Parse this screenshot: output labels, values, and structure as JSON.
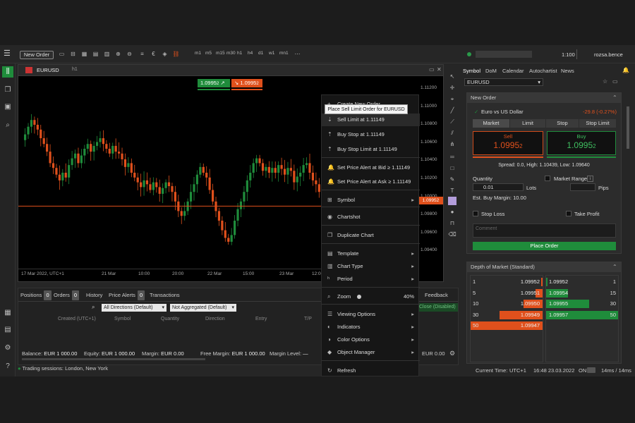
{
  "toolbar": {
    "new_order_label": "New Order",
    "leverage": "1:100",
    "username": "rozsa.bence",
    "period_labels": [
      "m1",
      "m5",
      "m15",
      "m30",
      "h1",
      "h4",
      "d1",
      "w1",
      "mn1"
    ]
  },
  "chart": {
    "symbol": "EURUSD",
    "period": "h1",
    "order_badges": {
      "buy_price": "1.0995",
      "buy_suffix": "2",
      "sell_price": "1.0995",
      "sell_suffix": "2"
    },
    "price_labels": [
      "1.11200",
      "1.11000",
      "1.10800",
      "1.10600",
      "1.10400",
      "1.10200",
      "1.10000",
      "1.09800",
      "1.09600",
      "1.09400"
    ],
    "current_price_label": "1.09952",
    "time_labels": [
      "17 Mar 2022, UTC+1",
      "21 Mar",
      "10:00",
      "20:00",
      "22 Mar",
      "15:00",
      "23 Mar",
      "12:00"
    ]
  },
  "chart_data": {
    "type": "candlestick",
    "symbol": "EURUSD",
    "period": "h1",
    "ylim": [
      1.093,
      1.113
    ],
    "current_price": 1.09952,
    "closes": [
      1.107,
      1.1078,
      1.1085,
      1.108,
      1.1075,
      1.1066,
      1.106,
      1.1052,
      1.104,
      1.1035,
      1.1028,
      1.1022,
      1.103,
      1.1025,
      1.1038,
      1.1045,
      1.105,
      1.104,
      1.1048,
      1.1055,
      1.106,
      1.1052,
      1.1058,
      1.1062,
      1.1066,
      1.106,
      1.1055,
      1.105,
      1.1058,
      1.1052,
      1.105,
      1.1044,
      1.1036,
      1.104,
      1.103,
      1.1025,
      1.102,
      1.1015,
      1.1022,
      1.1018,
      1.1012,
      1.102,
      1.1015,
      1.1008,
      1.1014,
      1.102,
      1.1016,
      1.101,
      1.1,
      1.099,
      1.0985,
      1.099,
      1.1,
      1.101,
      1.1018,
      1.1028,
      1.1036,
      1.103,
      1.1025,
      1.1012,
      1.1,
      1.099,
      1.098,
      1.097,
      1.0962,
      1.0958,
      1.0965,
      1.098,
      1.0992,
      1.1,
      1.101,
      1.1022,
      1.103,
      1.104,
      1.1045,
      1.104,
      1.1032,
      1.1036,
      1.103,
      1.1035,
      1.103,
      1.1038,
      1.1034,
      1.1028,
      1.1035,
      1.1032,
      1.102,
      1.1026,
      1.103,
      1.1038,
      1.104,
      1.103,
      1.1022,
      1.1018,
      1.101,
      1.1,
      1.0995
    ]
  },
  "context_menu": {
    "tooltip": "Place Sell Limit Order for EURUSD",
    "create_new_order": "Create New Order",
    "items": [
      {
        "label": "Sell Limit at 1.11149",
        "icon": "sell-limit-icon"
      },
      {
        "label": "Buy Stop at 1.11149",
        "icon": "buy-stop-icon"
      },
      {
        "label": "Buy Stop Limit at 1.11149",
        "icon": "buy-stop-limit-icon"
      },
      {
        "label": "Set Price Alert at Bid ≥ 1.11149",
        "icon": "bell-icon"
      },
      {
        "label": "Set Price Alert at Ask ≥ 1.11149",
        "icon": "bell-icon"
      },
      {
        "label": "Symbol",
        "icon": "symbol-icon"
      },
      {
        "label": "Chartshot",
        "icon": "camera-icon"
      },
      {
        "label": "Duplicate Chart",
        "icon": "duplicate-icon"
      },
      {
        "label": "Template",
        "icon": "template-icon"
      },
      {
        "label": "Chart Type",
        "icon": "chart-type-icon"
      },
      {
        "label": "Period",
        "icon": "period-icon"
      },
      {
        "label": "Zoom",
        "icon": "zoom-icon"
      },
      {
        "label": "Viewing Options",
        "icon": "viewing-icon"
      },
      {
        "label": "Indicators",
        "icon": "indicators-icon"
      },
      {
        "label": "Color Options",
        "icon": "color-icon"
      },
      {
        "label": "Object Manager",
        "icon": "object-manager-icon"
      },
      {
        "label": "Refresh",
        "icon": "refresh-icon"
      }
    ],
    "zoom_value": "40%"
  },
  "bottom": {
    "tabs": [
      {
        "label": "Positions",
        "count": "0"
      },
      {
        "label": "Orders",
        "count": "0"
      },
      {
        "label": "History",
        "count": ""
      },
      {
        "label": "Price Alerts",
        "count": "0"
      },
      {
        "label": "Transactions",
        "count": ""
      }
    ],
    "filter_direction": "All Directions (Default)",
    "filter_aggregation": "Not Aggregated (Default)",
    "columns": [
      "Created (UTC+1)",
      "Symbol",
      "Quantity",
      "Direction",
      "Entry",
      "T/P"
    ],
    "feedback": "Feedback",
    "close_label": "Close (Disabled)",
    "balance_label": "Balance:",
    "balance": "EUR 1 000.00",
    "equity_label": "Equity:",
    "equity": "EUR 1 000.00",
    "margin_label": "Margin:",
    "margin": "EUR 0.00",
    "free_margin_label": "Free Margin:",
    "free_margin": "EUR 1 000.00",
    "margin_level_label": "Margin Level:",
    "margin_level": "—",
    "right_value": "EUR 0.00",
    "sessions": "Trading sessions: London, New York"
  },
  "right_panel": {
    "tabs": [
      "Symbol",
      "DoM",
      "Calendar",
      "Autochartist",
      "News"
    ],
    "symbol": "EURUSD",
    "new_order_title": "New Order",
    "instrument": "Euro vs US Dollar",
    "change": "-29.8 (-0.27%)",
    "order_types": [
      "Market",
      "Limit",
      "Stop",
      "Stop Limit"
    ],
    "sell_label": "Sell",
    "sell_price": "1.0995",
    "sell_suffix": "2",
    "buy_label": "Buy",
    "buy_price": "1.0995",
    "buy_suffix": "2",
    "spread_info": "Spread: 0.0, High: 1.10439, Low: 1.09640",
    "quantity_label": "Quantity",
    "quantity_value": "0.01",
    "lots_label": "Lots",
    "market_range_label": "Market Range",
    "pips_label": "Pips",
    "margin_info": "Est. Buy Margin: 10.00",
    "stop_loss_label": "Stop Loss",
    "take_profit_label": "Take Profit",
    "comment_placeholder": "Comment",
    "place_order_label": "Place Order",
    "dom_title": "Depth of Market (Standard)",
    "dom_sell": [
      {
        "size": "1",
        "price": "1.09952"
      },
      {
        "size": "5",
        "price": "1.09951"
      },
      {
        "size": "10",
        "price": "1.09950"
      },
      {
        "size": "30",
        "price": "1.09949"
      },
      {
        "size": "50",
        "price": "1.09947"
      }
    ],
    "dom_buy": [
      {
        "size": "1",
        "price": "1.09952"
      },
      {
        "size": "15",
        "price": "1.09954"
      },
      {
        "size": "30",
        "price": "1.09955"
      },
      {
        "size": "50",
        "price": "1.09957"
      }
    ]
  },
  "footer": {
    "current_time_label": "Current Time:",
    "timezone": "UTC+1",
    "datetime": "16:48 23.03.2022",
    "on_label": "ON",
    "latency": "14ms / 14ms"
  },
  "colors": {
    "sell": "#e0501c",
    "buy": "#1f8c3b",
    "accent": "#b39ddb"
  }
}
